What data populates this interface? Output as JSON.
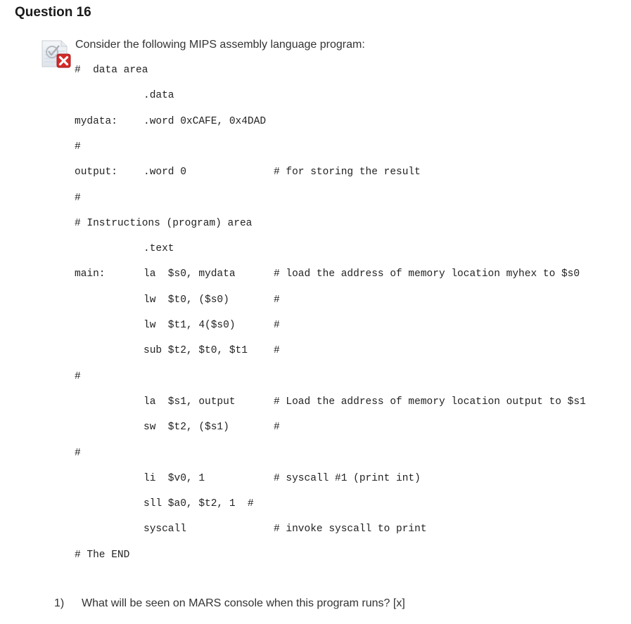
{
  "question": {
    "title": "Question 16",
    "status": "incorrect",
    "status_icon": "quiz-incorrect-icon",
    "intro": "Consider the following MIPS assembly language program:"
  },
  "code_lines": [
    {
      "label": "",
      "instr": "",
      "comment": "",
      "full": "#  data area"
    },
    {
      "label": "",
      "instr": ".data",
      "comment": ""
    },
    {
      "label": "mydata:",
      "instr": ".word 0xCAFE, 0x4DAD",
      "comment": ""
    },
    {
      "label": "#",
      "instr": "",
      "comment": ""
    },
    {
      "label": "output:",
      "instr": ".word 0",
      "comment": "# for storing the result"
    },
    {
      "label": "#",
      "instr": "",
      "comment": ""
    },
    {
      "label": "",
      "instr": "",
      "comment": "",
      "full": "# Instructions (program) area"
    },
    {
      "label": "",
      "instr": ".text",
      "comment": ""
    },
    {
      "label": "main:",
      "instr": "la  $s0, mydata",
      "comment": "# load the address of memory location myhex to $s0"
    },
    {
      "label": "",
      "instr": "lw  $t0, ($s0)",
      "comment": "#"
    },
    {
      "label": "",
      "instr": "lw  $t1, 4($s0)",
      "comment": "#"
    },
    {
      "label": "",
      "instr": "sub $t2, $t0, $t1",
      "comment": "#"
    },
    {
      "label": "#",
      "instr": "",
      "comment": ""
    },
    {
      "label": "",
      "instr": "la  $s1, output",
      "comment": "# Load the address of memory location output to $s1"
    },
    {
      "label": "",
      "instr": "sw  $t2, ($s1)",
      "comment": "#"
    },
    {
      "label": "#",
      "instr": "",
      "comment": ""
    },
    {
      "label": "",
      "instr": "li  $v0, 1",
      "comment": "# syscall #1 (print int)"
    },
    {
      "label": "",
      "instr": "sll $a0, $t2, 1  #",
      "comment": ""
    },
    {
      "label": "",
      "instr": "syscall",
      "comment": "# invoke syscall to print"
    },
    {
      "label": "",
      "instr": "",
      "comment": "",
      "full": "# The END"
    }
  ],
  "sub_question": {
    "number": "1)",
    "text": "What will be seen on MARS console when this program runs? [x]"
  }
}
